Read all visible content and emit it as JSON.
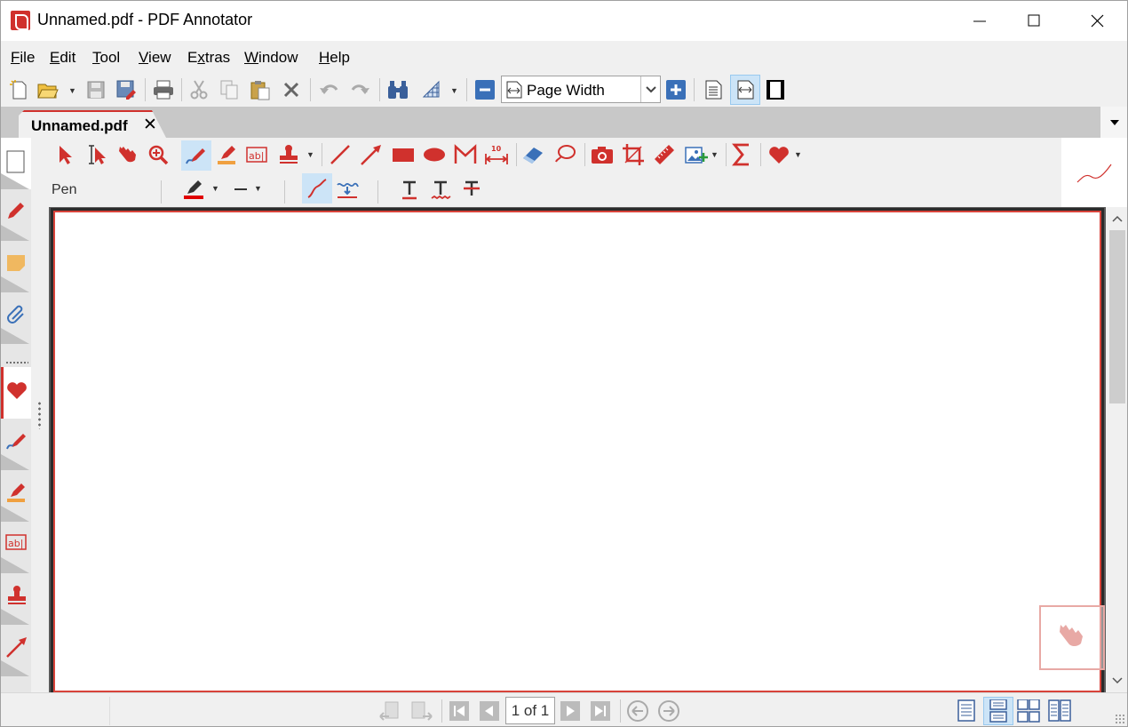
{
  "window": {
    "title": "Unnamed.pdf - PDF Annotator"
  },
  "menu": {
    "items": [
      {
        "first": "F",
        "rest": "ile"
      },
      {
        "first": "E",
        "rest": "dit"
      },
      {
        "first": "T",
        "rest": "ool"
      },
      {
        "first": "V",
        "rest": "iew"
      },
      {
        "first": "",
        "pre": "E",
        "u": "x",
        "rest": "tras"
      },
      {
        "first": "W",
        "rest": "indow"
      },
      {
        "first": "H",
        "rest": "elp"
      }
    ]
  },
  "toolbar": {
    "zoom_value": "Page Width"
  },
  "tab": {
    "label": "Unnamed.pdf",
    "close": "✕"
  },
  "annotation_toolbar": {
    "current_tool_label": "Pen"
  },
  "status": {
    "page_indicator": "1 of 1"
  },
  "colors": {
    "accent_red": "#d0312d",
    "selected_bg": "#cce4f7",
    "page_border": "#d8433a"
  }
}
